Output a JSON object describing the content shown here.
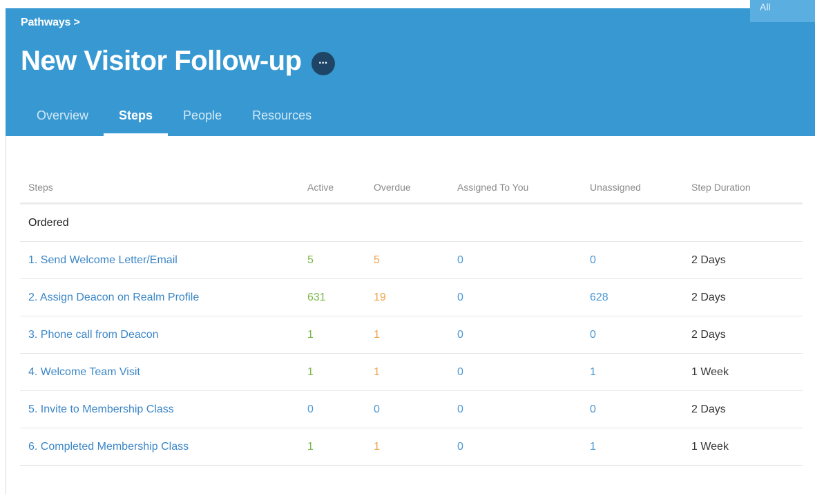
{
  "corner_badge": "All",
  "breadcrumb": "Pathways >",
  "page": {
    "title": "New Visitor Follow-up",
    "more_label": "···"
  },
  "tabs": [
    {
      "label": "Overview",
      "active": false
    },
    {
      "label": "Steps",
      "active": true
    },
    {
      "label": "People",
      "active": false
    },
    {
      "label": "Resources",
      "active": false
    }
  ],
  "table": {
    "headers": [
      "Steps",
      "Active",
      "Overdue",
      "Assigned To You",
      "Unassigned",
      "Step Duration"
    ],
    "group_label": "Ordered",
    "rows": [
      {
        "step": "1. Send Welcome Letter/Email",
        "active": "5",
        "overdue": "5",
        "assigned": "0",
        "unassigned": "0",
        "duration": "2 Days"
      },
      {
        "step": "2. Assign Deacon on Realm Profile",
        "active": "631",
        "overdue": "19",
        "assigned": "0",
        "unassigned": "628",
        "duration": "2 Days"
      },
      {
        "step": "3. Phone call from Deacon",
        "active": "1",
        "overdue": "1",
        "assigned": "0",
        "unassigned": "0",
        "duration": "2 Days"
      },
      {
        "step": "4. Welcome Team Visit",
        "active": "1",
        "overdue": "1",
        "assigned": "0",
        "unassigned": "1",
        "duration": "1 Week"
      },
      {
        "step": "5. Invite to Membership Class",
        "active": "0",
        "overdue": "0",
        "assigned": "0",
        "unassigned": "0",
        "duration": "2 Days"
      },
      {
        "step": "6. Completed Membership Class",
        "active": "1",
        "overdue": "1",
        "assigned": "0",
        "unassigned": "1",
        "duration": "1 Week"
      }
    ]
  },
  "colors": {
    "header_bg": "#3899d2",
    "link": "#3b86c6",
    "active_count": "#7ab648",
    "overdue_count": "#f0a34c",
    "zero_or_assigned": "#4a97d3"
  }
}
